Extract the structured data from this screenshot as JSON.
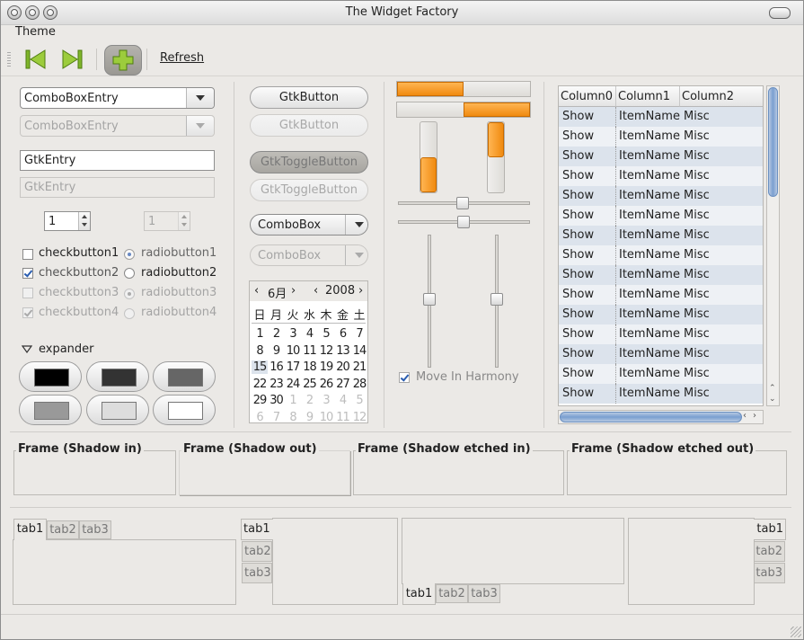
{
  "window": {
    "title": "The Widget Factory"
  },
  "menu": {
    "theme": "Theme"
  },
  "toolbar": {
    "refresh_label": "Refresh"
  },
  "left": {
    "combo_entry": "ComboBoxEntry",
    "combo_entry_disabled": "ComboBoxEntry",
    "entry": "GtkEntry",
    "entry_disabled": "GtkEntry",
    "spin1": "1",
    "spin2": "1",
    "checks": [
      "checkbutton1",
      "checkbutton2",
      "checkbutton3",
      "checkbutton4"
    ],
    "radios": [
      "radiobutton1",
      "radiobutton2",
      "radiobutton3",
      "radiobutton4"
    ],
    "expander": "expander",
    "color_swatches": [
      "#000000",
      "#333333",
      "#666666",
      "#999999",
      "#dddddd",
      "#ffffff"
    ]
  },
  "middle": {
    "button": "GtkButton",
    "button_disabled": "GtkButton",
    "toggle": "GtkToggleButton",
    "toggle_disabled": "GtkToggleButton",
    "combobox": "ComboBox",
    "combobox_disabled": "ComboBox"
  },
  "calendar": {
    "month": "6月",
    "year": "2008",
    "weekdays": [
      "日",
      "月",
      "火",
      "水",
      "木",
      "金",
      "土"
    ],
    "weeks": [
      [
        {
          "d": "1",
          "o": false
        },
        {
          "d": "2",
          "o": false
        },
        {
          "d": "3",
          "o": false
        },
        {
          "d": "4",
          "o": false
        },
        {
          "d": "5",
          "o": false
        },
        {
          "d": "6",
          "o": false
        },
        {
          "d": "7",
          "o": false
        }
      ],
      [
        {
          "d": "8",
          "o": false
        },
        {
          "d": "9",
          "o": false
        },
        {
          "d": "10",
          "o": false
        },
        {
          "d": "11",
          "o": false
        },
        {
          "d": "12",
          "o": false
        },
        {
          "d": "13",
          "o": false
        },
        {
          "d": "14",
          "o": false
        }
      ],
      [
        {
          "d": "15",
          "o": false,
          "sel": true
        },
        {
          "d": "16",
          "o": false
        },
        {
          "d": "17",
          "o": false
        },
        {
          "d": "18",
          "o": false
        },
        {
          "d": "19",
          "o": false
        },
        {
          "d": "20",
          "o": false
        },
        {
          "d": "21",
          "o": false
        }
      ],
      [
        {
          "d": "22",
          "o": false
        },
        {
          "d": "23",
          "o": false
        },
        {
          "d": "24",
          "o": false
        },
        {
          "d": "25",
          "o": false
        },
        {
          "d": "26",
          "o": false
        },
        {
          "d": "27",
          "o": false
        },
        {
          "d": "28",
          "o": false
        }
      ],
      [
        {
          "d": "29",
          "o": false
        },
        {
          "d": "30",
          "o": false
        },
        {
          "d": "1",
          "o": true
        },
        {
          "d": "2",
          "o": true
        },
        {
          "d": "3",
          "o": true
        },
        {
          "d": "4",
          "o": true
        },
        {
          "d": "5",
          "o": true
        }
      ],
      [
        {
          "d": "6",
          "o": true
        },
        {
          "d": "7",
          "o": true
        },
        {
          "d": "8",
          "o": true
        },
        {
          "d": "9",
          "o": true
        },
        {
          "d": "10",
          "o": true
        },
        {
          "d": "11",
          "o": true
        },
        {
          "d": "12",
          "o": true
        }
      ]
    ]
  },
  "progress": {
    "h1_fraction": 0.5,
    "h2_fraction": 0.5,
    "v1_fraction": 0.5,
    "v2_fraction": 0.5,
    "accent": "#f08a10"
  },
  "harmony": {
    "label": "Move In Harmony"
  },
  "tree": {
    "columns": [
      "Column0",
      "Column1",
      "Column2"
    ],
    "rows": [
      [
        "Show",
        "ItemName",
        "Misc"
      ],
      [
        "Show",
        "ItemName",
        "Misc"
      ],
      [
        "Show",
        "ItemName",
        "Misc"
      ],
      [
        "Show",
        "ItemName",
        "Misc"
      ],
      [
        "Show",
        "ItemName",
        "Misc"
      ],
      [
        "Show",
        "ItemName",
        "Misc"
      ],
      [
        "Show",
        "ItemName",
        "Misc"
      ],
      [
        "Show",
        "ItemName",
        "Misc"
      ],
      [
        "Show",
        "ItemName",
        "Misc"
      ],
      [
        "Show",
        "ItemName",
        "Misc"
      ],
      [
        "Show",
        "ItemName",
        "Misc"
      ],
      [
        "Show",
        "ItemName",
        "Misc"
      ],
      [
        "Show",
        "ItemName",
        "Misc"
      ],
      [
        "Show",
        "ItemName",
        "Misc"
      ],
      [
        "Show",
        "ItemName",
        "Misc"
      ]
    ]
  },
  "frames": [
    "Frame (Shadow in)",
    "Frame (Shadow out)",
    "Frame (Shadow etched in)",
    "Frame (Shadow etched out)"
  ],
  "notebooks": {
    "tabs": [
      "tab1",
      "tab2",
      "tab3"
    ]
  }
}
